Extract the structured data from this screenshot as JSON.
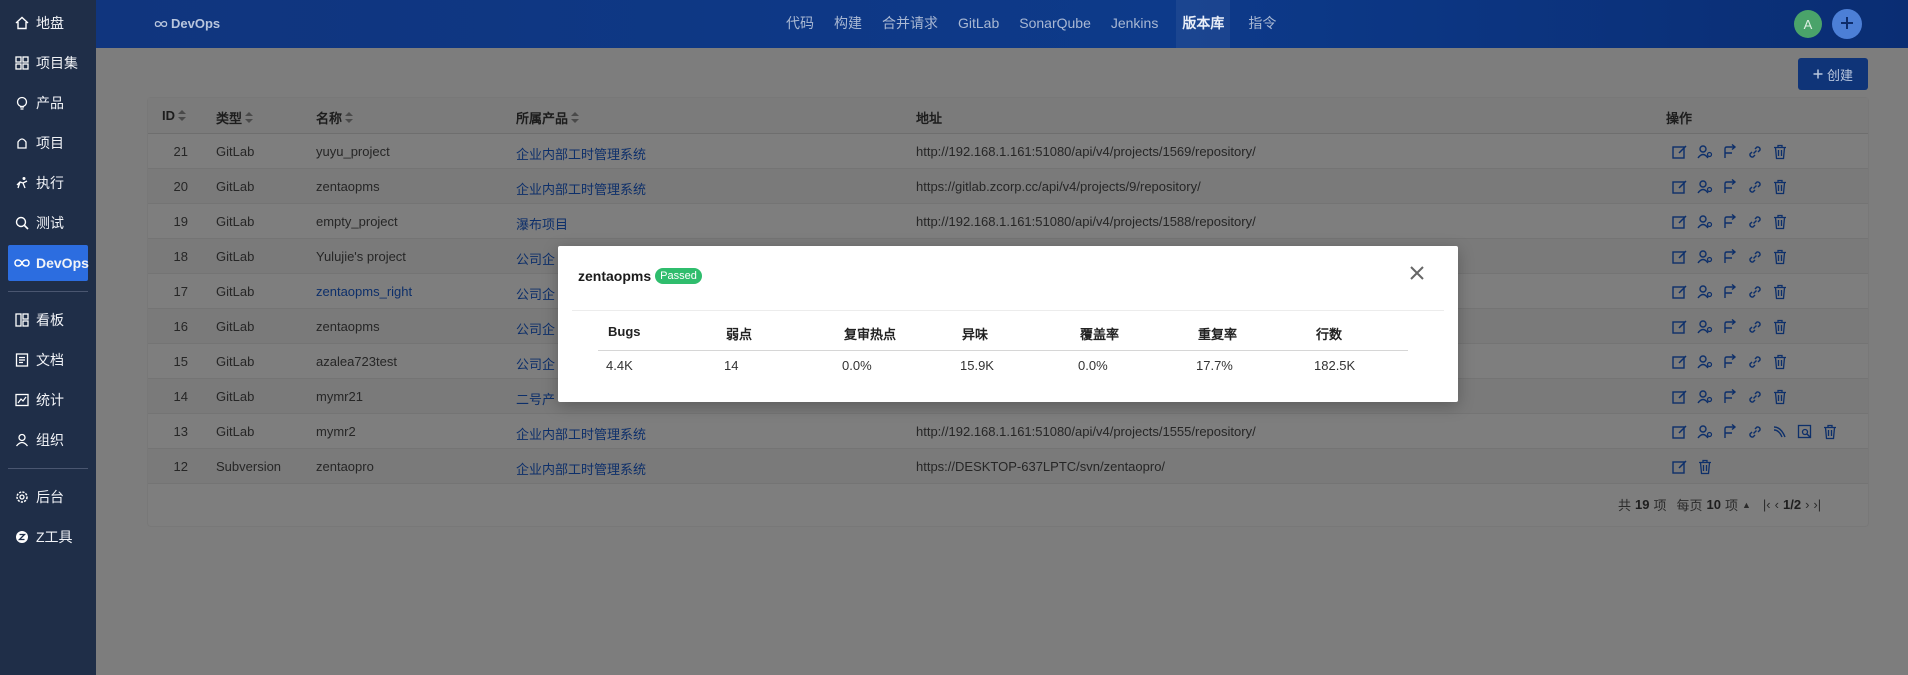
{
  "sidebar": {
    "items": [
      {
        "label": "地盘",
        "icon": "home-icon"
      },
      {
        "label": "项目集",
        "icon": "grid-icon"
      },
      {
        "label": "产品",
        "icon": "bulb-icon"
      },
      {
        "label": "项目",
        "icon": "project-icon"
      },
      {
        "label": "执行",
        "icon": "run-icon"
      },
      {
        "label": "测试",
        "icon": "test-icon"
      },
      {
        "label": "DevOps",
        "icon": "infinity-icon"
      },
      {
        "label": "看板",
        "icon": "kanban-icon"
      },
      {
        "label": "文档",
        "icon": "doc-icon"
      },
      {
        "label": "统计",
        "icon": "chart-icon"
      },
      {
        "label": "组织",
        "icon": "user-icon"
      },
      {
        "label": "后台",
        "icon": "gear-icon"
      },
      {
        "label": "Z工具",
        "icon": "ztool-icon"
      }
    ],
    "active_index": 6
  },
  "header": {
    "brand": "DevOps",
    "nav": [
      "代码",
      "构建",
      "合并请求",
      "GitLab",
      "SonarQube",
      "Jenkins",
      "版本库",
      "指令"
    ],
    "nav_active_index": 6,
    "avatar_letter": "A"
  },
  "toolbar": {
    "create_label": "创建"
  },
  "table": {
    "headers": {
      "id": "ID",
      "type": "类型",
      "name": "名称",
      "product": "所属产品",
      "address": "地址",
      "ops": "操作"
    },
    "rows": [
      {
        "id": "21",
        "type": "GitLab",
        "name": "yuyu_project",
        "product": "企业内部工时管理系统",
        "address": "http://192.168.1.161:51080/api/v4/projects/1569/repository/",
        "ops": 5
      },
      {
        "id": "20",
        "type": "GitLab",
        "name": "zentaopms",
        "product": "企业内部工时管理系统",
        "address": "https://gitlab.zcorp.cc/api/v4/projects/9/repository/",
        "ops": 5
      },
      {
        "id": "19",
        "type": "GitLab",
        "name": "empty_project",
        "product": "瀑布项目",
        "address": "http://192.168.1.161:51080/api/v4/projects/1588/repository/",
        "ops": 5
      },
      {
        "id": "18",
        "type": "GitLab",
        "name": "Yulujie's project",
        "product": "公司企",
        "address": "",
        "ops": 5
      },
      {
        "id": "17",
        "type": "GitLab",
        "name": "zentaopms_right",
        "product": "公司企",
        "address": "",
        "ops": 5
      },
      {
        "id": "16",
        "type": "GitLab",
        "name": "zentaopms",
        "product": "公司企",
        "address": "",
        "ops": 5
      },
      {
        "id": "15",
        "type": "GitLab",
        "name": "azalea723test",
        "product": "公司企",
        "address": "",
        "ops": 5
      },
      {
        "id": "14",
        "type": "GitLab",
        "name": "mymr21",
        "product": "二号产",
        "address": "",
        "ops": 5
      },
      {
        "id": "13",
        "type": "GitLab",
        "name": "mymr2",
        "product": "企业内部工时管理系统",
        "address": "http://192.168.1.161:51080/api/v4/projects/1555/repository/",
        "ops": 7
      },
      {
        "id": "12",
        "type": "Subversion",
        "name": "zentaopro",
        "product": "企业内部工时管理系统",
        "address": "https://DESKTOP-637LPTC/svn/zentaopro/",
        "ops": 2
      }
    ]
  },
  "pager": {
    "total_prefix": "共",
    "total": "19",
    "total_suffix": "项",
    "per_prefix": "每页",
    "per": "10",
    "per_suffix": "项",
    "page": "1/2"
  },
  "modal": {
    "title": "zentaopms",
    "badge": "Passed",
    "columns": [
      "Bugs",
      "弱点",
      "复审热点",
      "异味",
      "覆盖率",
      "重复率",
      "行数"
    ],
    "values": [
      "4.4K",
      "14",
      "0.0%",
      "15.9K",
      "0.0%",
      "17.7%",
      "182.5K"
    ]
  },
  "colors": {
    "sidebar_bg": "#1f2e48",
    "active_blue": "#2c6de0",
    "header_blue": "#10357e",
    "passed_green": "#2fbd6d",
    "link_blue": "#0d2f6a"
  }
}
